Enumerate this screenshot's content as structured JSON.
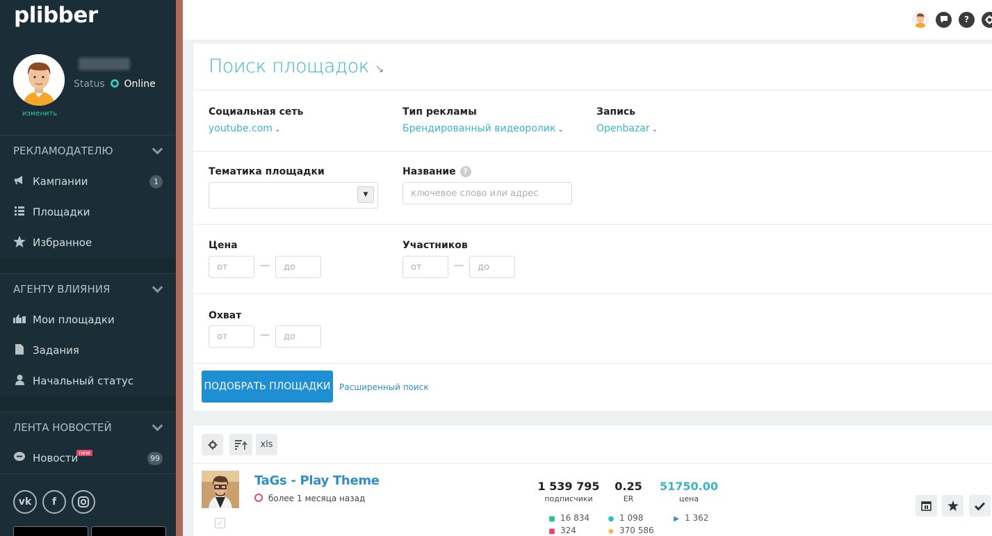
{
  "app": {
    "logo": "plibber"
  },
  "profile": {
    "status_label": "Status",
    "status_value": "Online",
    "change_link": "изменить"
  },
  "sidebar": {
    "sections": [
      {
        "title": "РЕКЛАМОДАТЕЛЮ",
        "items": [
          {
            "label": "Кампании",
            "icon": "megaphone-icon",
            "badge": "1"
          },
          {
            "label": "Площадки",
            "icon": "list-icon"
          },
          {
            "label": "Избранное",
            "icon": "star-icon"
          }
        ]
      },
      {
        "title": "АГЕНТУ ВЛИЯНИЯ",
        "items": [
          {
            "label": "Мои площадки",
            "icon": "thumbs-icon"
          },
          {
            "label": "Задания",
            "icon": "document-icon"
          },
          {
            "label": "Начальный статус",
            "icon": "user-icon"
          }
        ]
      },
      {
        "title": "ЛЕНТА НОВОСТЕЙ",
        "items": [
          {
            "label": "Новости",
            "icon": "chat-icon",
            "new_badge": "new",
            "badge": "99"
          }
        ]
      }
    ],
    "social": [
      "vk-icon",
      "facebook-icon",
      "instagram-icon"
    ]
  },
  "topbar": {
    "icons": [
      "user-avatar-icon",
      "chat-bubble-icon",
      "help-icon",
      "settings-icon"
    ]
  },
  "search": {
    "title": "Поиск площадок",
    "social_network": {
      "label": "Социальная сеть",
      "value": "youtube.com"
    },
    "ad_type": {
      "label": "Тип рекламы",
      "value": "Брендированный видеоролик"
    },
    "post": {
      "label": "Запись",
      "value": "Openbazar"
    },
    "topic": {
      "label": "Тематика площадки",
      "value": ""
    },
    "name": {
      "label": "Название",
      "placeholder": "ключевое слово или адрес"
    },
    "price": {
      "label": "Цена",
      "from_placeholder": "от",
      "to_placeholder": "до"
    },
    "members": {
      "label": "Участников",
      "from_placeholder": "от",
      "to_placeholder": "до"
    },
    "reach": {
      "label": "Охват",
      "from_placeholder": "от",
      "to_placeholder": "до"
    },
    "dash": "—",
    "submit_label": "ПОДОБРАТЬ ПЛОЩАДКИ",
    "advanced_link": "Расширенный поиск"
  },
  "results": {
    "toolbar": {
      "xls_label": "xls"
    },
    "items": [
      {
        "title": "TaGs - Play Theme",
        "time": "более 1 месяца назад",
        "subscribers": "1 539 795",
        "subscribers_label": "подписчики",
        "er": "0.25",
        "er_label": "ER",
        "price": "51750.00",
        "price_label": "цена",
        "likes": "16 834",
        "dislikes": "324",
        "comments": "1 098",
        "views": "370 586",
        "plays": "1 362"
      }
    ]
  },
  "colors": {
    "accent": "#39b5c4",
    "primary": "#1e8fd3",
    "sidebar": "#1b2d36"
  }
}
